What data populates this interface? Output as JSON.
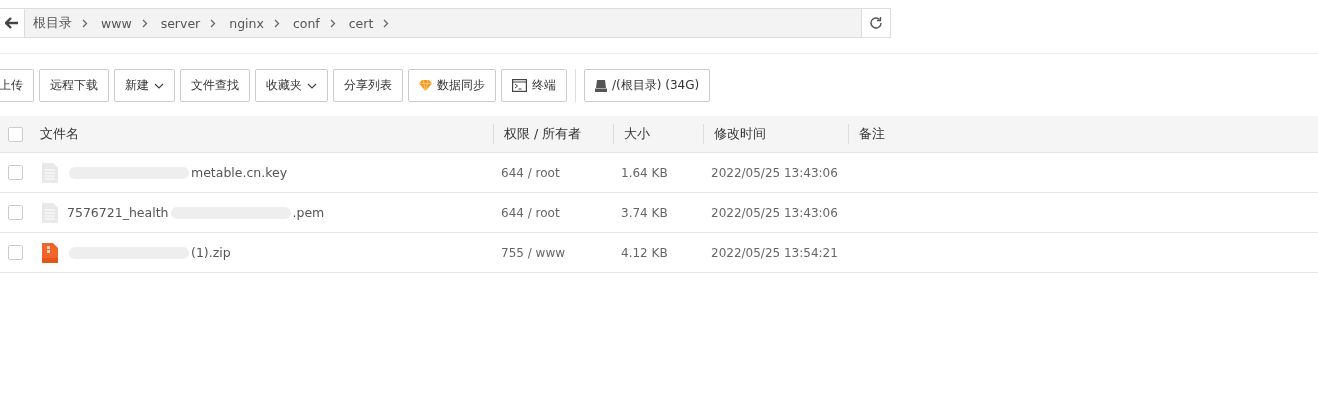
{
  "breadcrumb": [
    "根目录",
    "www",
    "server",
    "nginx",
    "conf",
    "cert"
  ],
  "toolbar": [
    {
      "label": "上传",
      "kind": "plain"
    },
    {
      "label": "远程下载",
      "kind": "plain"
    },
    {
      "label": "新建",
      "kind": "dropdown"
    },
    {
      "label": "文件查找",
      "kind": "plain"
    },
    {
      "label": "收藏夹",
      "kind": "dropdown"
    },
    {
      "label": "分享列表",
      "kind": "plain"
    },
    {
      "label": "数据同步",
      "kind": "sync"
    },
    {
      "label": "终端",
      "kind": "terminal"
    },
    {
      "label": "/(根目录) (34G)",
      "kind": "disk"
    }
  ],
  "table": {
    "all_checked": false,
    "columns": [
      "文件名",
      "权限 / 所有者",
      "大小",
      "修改时间",
      "备注"
    ],
    "rows": [
      {
        "checked": false,
        "kind": "text",
        "name_end": "metable.cn.key",
        "permission": "644 / root",
        "size": "1.64 KB",
        "modified": "2022/05/25 13:43:06"
      },
      {
        "checked": false,
        "kind": "text",
        "name_start": "7576721_health",
        "name_end": ".pem",
        "permission": "644 / root",
        "size": "3.74 KB",
        "modified": "2022/05/25 13:43:06"
      },
      {
        "checked": false,
        "kind": "zip",
        "name_end": "(1).zip",
        "permission": "755 / www",
        "size": "4.12 KB",
        "modified": "2022/05/25 13:54:21"
      }
    ]
  }
}
